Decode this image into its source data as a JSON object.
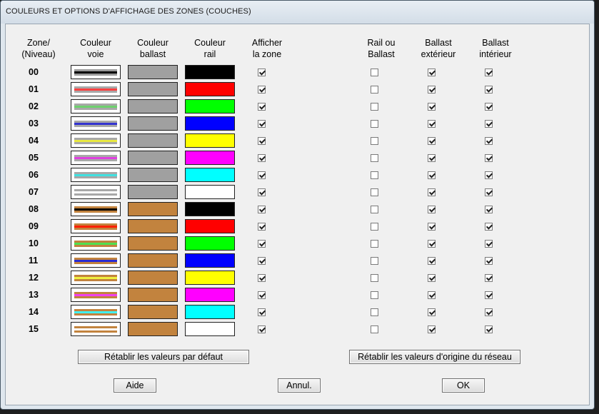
{
  "window": {
    "title": "COULEURS ET OPTIONS D'AFFICHAGE DES ZONES (COUCHES)"
  },
  "headers": {
    "zone": "Zone/\n(Niveau)",
    "couleur_voie": "Couleur\nvoie",
    "couleur_ballast": "Couleur\nballast",
    "couleur_rail": "Couleur\nrail",
    "afficher": "Afficher\nla zone",
    "rail_ou_ballast": "Rail ou\nBallast",
    "ballast_exterieur": "Ballast\nextérieur",
    "ballast_interieur": "Ballast\nintérieur"
  },
  "zones": [
    {
      "id": "00",
      "voie": [
        "#9a9a9a",
        "#000000"
      ],
      "ballast": "#a0a0a0",
      "rail": "#000000",
      "afficher": true,
      "rail_ou_ballast": false,
      "ext": true,
      "int": true
    },
    {
      "id": "01",
      "voie": [
        "#a8a8a8",
        "#ff4040"
      ],
      "ballast": "#a0a0a0",
      "rail": "#ff0000",
      "afficher": true,
      "rail_ou_ballast": false,
      "ext": true,
      "int": true
    },
    {
      "id": "02",
      "voie": [
        "#a8a8a8",
        "#6ed06e"
      ],
      "ballast": "#a0a0a0",
      "rail": "#00ff00",
      "afficher": true,
      "rail_ou_ballast": false,
      "ext": true,
      "int": true
    },
    {
      "id": "03",
      "voie": [
        "#a8a8a8",
        "#3434d0"
      ],
      "ballast": "#a0a0a0",
      "rail": "#0000ff",
      "afficher": true,
      "rail_ou_ballast": false,
      "ext": true,
      "int": true
    },
    {
      "id": "04",
      "voie": [
        "#a8a8a8",
        "#e8e840"
      ],
      "ballast": "#a0a0a0",
      "rail": "#ffff00",
      "afficher": true,
      "rail_ou_ballast": false,
      "ext": true,
      "int": true
    },
    {
      "id": "05",
      "voie": [
        "#a8a8a8",
        "#e040e0"
      ],
      "ballast": "#a0a0a0",
      "rail": "#ff00ff",
      "afficher": true,
      "rail_ou_ballast": false,
      "ext": true,
      "int": true
    },
    {
      "id": "06",
      "voie": [
        "#a8a8a8",
        "#40e0e0"
      ],
      "ballast": "#a0a0a0",
      "rail": "#00ffff",
      "afficher": true,
      "rail_ou_ballast": false,
      "ext": true,
      "int": true
    },
    {
      "id": "07",
      "voie": [
        "#a8a8a8",
        "#ffffff"
      ],
      "ballast": "#a0a0a0",
      "rail": "#ffffff",
      "afficher": true,
      "rail_ou_ballast": false,
      "ext": true,
      "int": true
    },
    {
      "id": "08",
      "voie": [
        "#c2833e",
        "#000000"
      ],
      "ballast": "#c2833e",
      "rail": "#000000",
      "afficher": true,
      "rail_ou_ballast": false,
      "ext": true,
      "int": true
    },
    {
      "id": "09",
      "voie": [
        "#c2833e",
        "#ff2000"
      ],
      "ballast": "#c2833e",
      "rail": "#ff0000",
      "afficher": true,
      "rail_ou_ballast": false,
      "ext": true,
      "int": true
    },
    {
      "id": "10",
      "voie": [
        "#c2833e",
        "#50e050"
      ],
      "ballast": "#c2833e",
      "rail": "#00ff00",
      "afficher": true,
      "rail_ou_ballast": false,
      "ext": true,
      "int": true
    },
    {
      "id": "11",
      "voie": [
        "#c2833e",
        "#2a2ad0"
      ],
      "ballast": "#c2833e",
      "rail": "#0000ff",
      "afficher": true,
      "rail_ou_ballast": false,
      "ext": true,
      "int": true
    },
    {
      "id": "12",
      "voie": [
        "#c2833e",
        "#f0f040"
      ],
      "ballast": "#c2833e",
      "rail": "#ffff00",
      "afficher": true,
      "rail_ou_ballast": false,
      "ext": true,
      "int": true
    },
    {
      "id": "13",
      "voie": [
        "#c2833e",
        "#f040f0"
      ],
      "ballast": "#c2833e",
      "rail": "#ff00ff",
      "afficher": true,
      "rail_ou_ballast": false,
      "ext": true,
      "int": true
    },
    {
      "id": "14",
      "voie": [
        "#c2833e",
        "#40f0f0"
      ],
      "ballast": "#c2833e",
      "rail": "#00ffff",
      "afficher": true,
      "rail_ou_ballast": false,
      "ext": true,
      "int": true
    },
    {
      "id": "15",
      "voie": [
        "#c2833e",
        "#ffffff"
      ],
      "ballast": "#c2833e",
      "rail": "#ffffff",
      "afficher": true,
      "rail_ou_ballast": false,
      "ext": true,
      "int": true
    }
  ],
  "buttons": {
    "reset_defaults": "Rétablir les valeurs par défaut",
    "reset_network": "Rétablir les valeurs d'origine du réseau",
    "help": "Aide",
    "cancel": "Annul.",
    "ok": "OK"
  }
}
